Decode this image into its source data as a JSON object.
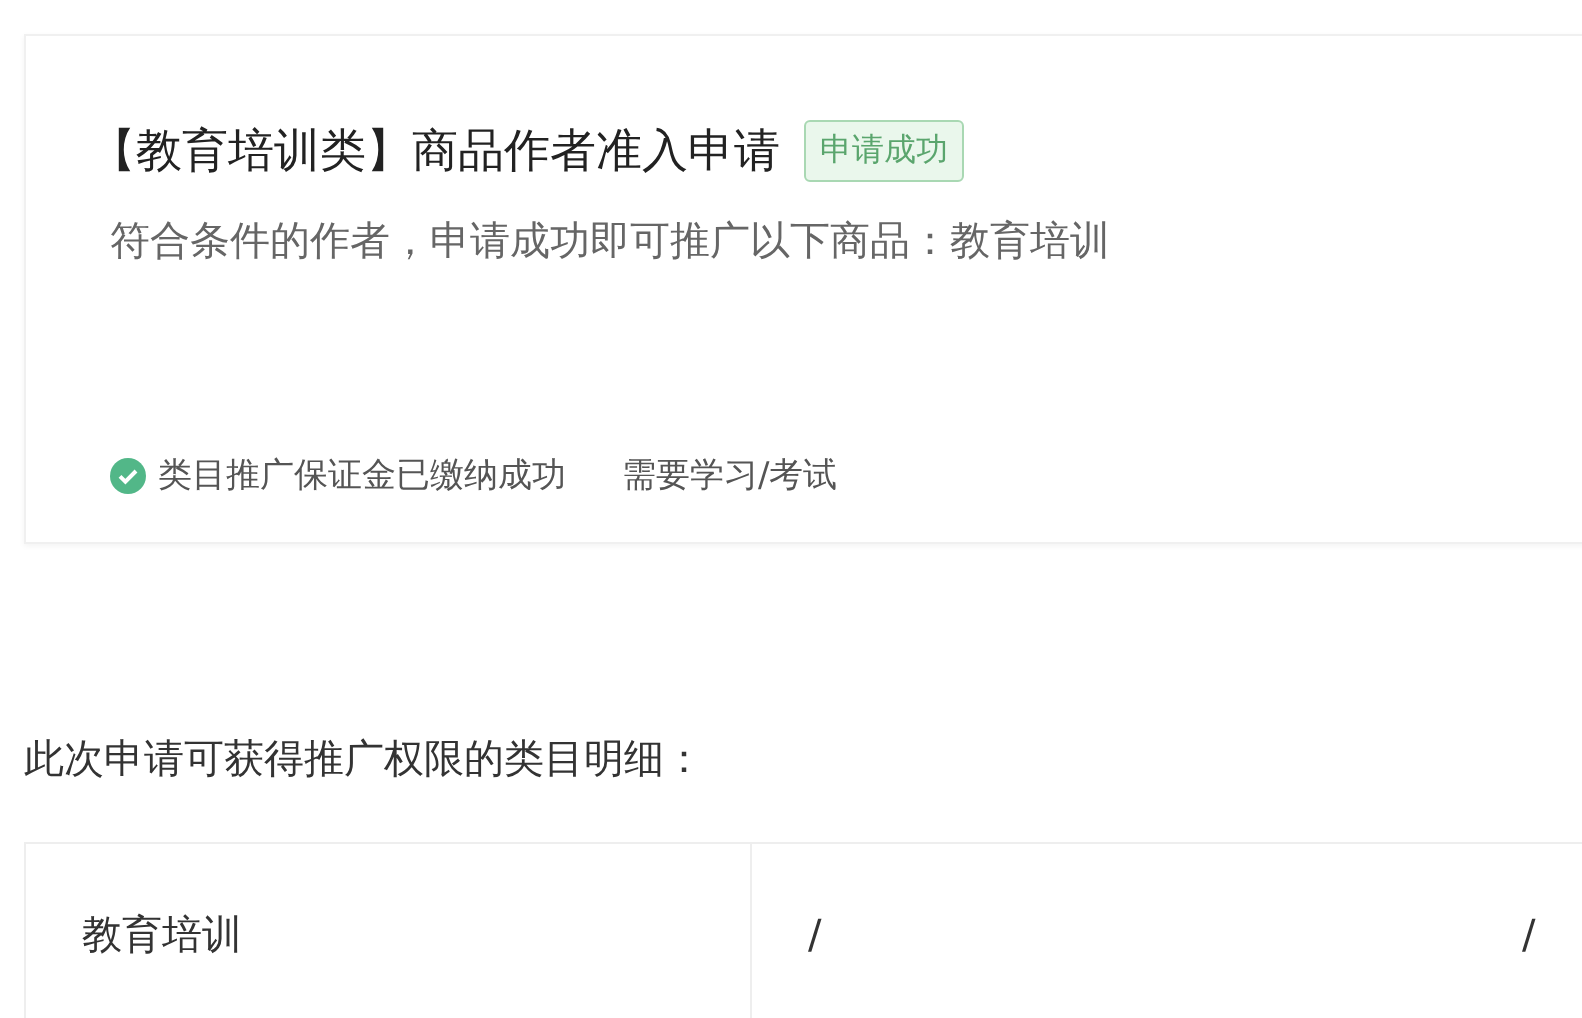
{
  "card": {
    "title": "【教育培训类】商品作者准入申请",
    "badge": "申请成功",
    "description": "符合条件的作者，申请成功即可推广以下商品：教育培训",
    "requirements": [
      {
        "kind": "done",
        "label": "类目推广保证金已缴纳成功"
      },
      {
        "kind": "plain",
        "label": "需要学习/考试"
      }
    ]
  },
  "section_title": "此次申请可获得推广权限的类目明细：",
  "table": {
    "rows": [
      {
        "cells": [
          "教育培训",
          "/",
          "/"
        ]
      }
    ]
  }
}
